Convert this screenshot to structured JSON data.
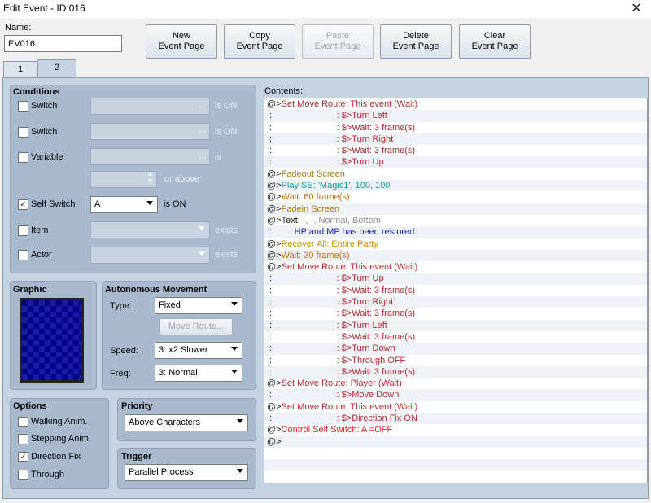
{
  "window": {
    "title": "Edit Event - ID:016"
  },
  "name": {
    "label": "Name:",
    "value": "EV016"
  },
  "toolbar": {
    "new": "New\nEvent Page",
    "copy": "Copy\nEvent Page",
    "paste": "Paste\nEvent Page",
    "delete": "Delete\nEvent Page",
    "clear": "Clear\nEvent Page"
  },
  "tabs": [
    "1",
    "2"
  ],
  "conditions": {
    "title": "Conditions",
    "switch1": {
      "label": "Switch",
      "suffix": "is ON",
      "dots": "..."
    },
    "switch2": {
      "label": "Switch",
      "suffix": "is ON",
      "dots": "..."
    },
    "variable": {
      "label": "Variable",
      "suffix": "is",
      "dots": "...",
      "above": "or above"
    },
    "self_switch": {
      "label": "Self Switch",
      "value": "A",
      "suffix": "is ON"
    },
    "item": {
      "label": "Item",
      "suffix": "exists"
    },
    "actor": {
      "label": "Actor",
      "suffix": "exists"
    }
  },
  "graphic": {
    "title": "Graphic"
  },
  "movement": {
    "title": "Autonomous Movement",
    "type_label": "Type:",
    "type_value": "Fixed",
    "route_button": "Move Route...",
    "speed_label": "Speed:",
    "speed_value": "3: x2 Slower",
    "freq_label": "Freq:",
    "freq_value": "3: Normal"
  },
  "options": {
    "title": "Options",
    "walking": "Walking Anim.",
    "stepping": "Stepping Anim.",
    "direction_fix": "Direction Fix",
    "through": "Through"
  },
  "priority": {
    "title": "Priority",
    "value": "Above Characters"
  },
  "trigger": {
    "title": "Trigger",
    "value": "Parallel Process"
  },
  "contents": {
    "label": "Contents:",
    "lines": [
      {
        "p": "@>",
        "t": "Set Move Route: This event (Wait)",
        "c": "c-route"
      },
      {
        "p": " :                          ",
        "t": ": $>Turn Left",
        "c": "c-route"
      },
      {
        "p": " :                          ",
        "t": ": $>Wait: 3 frame(s)",
        "c": "c-route"
      },
      {
        "p": " :                          ",
        "t": ": $>Turn Right",
        "c": "c-route"
      },
      {
        "p": " :                          ",
        "t": ": $>Wait: 3 frame(s)",
        "c": "c-route"
      },
      {
        "p": " :                          ",
        "t": ": $>Turn Up",
        "c": "c-route"
      },
      {
        "p": "@>",
        "t": "Fadeout Screen",
        "c": "c-fade"
      },
      {
        "p": "@>",
        "t": "Play SE: 'Magic1', 100, 100",
        "c": "c-se"
      },
      {
        "p": "@>",
        "t": "Wait: 60 frame(s)",
        "c": "c-wait"
      },
      {
        "p": "@>",
        "t": "Fadein Screen",
        "c": "c-fade"
      },
      {
        "p": "@>",
        "t": "Text: ",
        "c": "c-text",
        "t2": "-, -, Normal, Bottom",
        "c2": "c-textgray"
      },
      {
        "p": " :       ",
        "t": ": HP and MP has been restored.",
        "c": "c-msg"
      },
      {
        "p": "@>",
        "t": "Recover All: Entire Party",
        "c": "c-recover"
      },
      {
        "p": "@>",
        "t": "Wait: 30 frame(s)",
        "c": "c-wait"
      },
      {
        "p": "@>",
        "t": "Set Move Route: This event (Wait)",
        "c": "c-route"
      },
      {
        "p": " :                          ",
        "t": ": $>Turn Up",
        "c": "c-route"
      },
      {
        "p": " :                          ",
        "t": ": $>Wait: 3 frame(s)",
        "c": "c-route"
      },
      {
        "p": " :                          ",
        "t": ": $>Turn Right",
        "c": "c-route"
      },
      {
        "p": " :                          ",
        "t": ": $>Wait: 3 frame(s)",
        "c": "c-route"
      },
      {
        "p": " :                          ",
        "t": ": $>Turn Left",
        "c": "c-route"
      },
      {
        "p": " :                          ",
        "t": ": $>Wait: 3 frame(s)",
        "c": "c-route"
      },
      {
        "p": " :                          ",
        "t": ": $>Turn Down",
        "c": "c-route"
      },
      {
        "p": " :                          ",
        "t": ": $>Through OFF",
        "c": "c-route"
      },
      {
        "p": " :                          ",
        "t": ": $>Wait: 3 frame(s)",
        "c": "c-route"
      },
      {
        "p": "@>",
        "t": "Set Move Route: Player (Wait)",
        "c": "c-route"
      },
      {
        "p": " :                          ",
        "t": ": $>Move Down",
        "c": "c-route"
      },
      {
        "p": "@>",
        "t": "Set Move Route: This event (Wait)",
        "c": "c-route"
      },
      {
        "p": " :                          ",
        "t": ": $>Direction Fix ON",
        "c": "c-route"
      },
      {
        "p": "@>",
        "t": "Control Self Switch: A =OFF",
        "c": "c-switch"
      },
      {
        "p": "@>",
        "t": "",
        "c": "c-text"
      }
    ]
  }
}
